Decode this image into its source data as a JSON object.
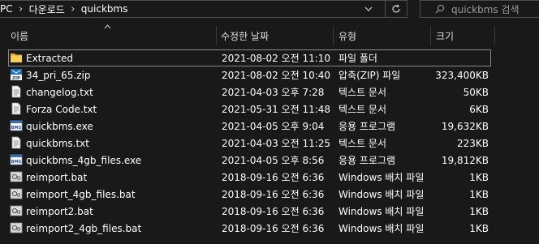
{
  "address_bar": {
    "crumbs": [
      "PC",
      "다운로드",
      "quickbms"
    ]
  },
  "search": {
    "placeholder": "quickbms 검색"
  },
  "columns": {
    "name": "이름",
    "date": "수정한 날짜",
    "type": "유형",
    "size": "크기"
  },
  "files": [
    {
      "name": "Extracted",
      "date": "2021-08-02 오전 11:10",
      "type": "파일 폴더",
      "size": "",
      "icon": "folder-icon",
      "selected": true
    },
    {
      "name": "34_pri_65.zip",
      "date": "2021-08-02 오전 10:40",
      "type": "압축(ZIP) 파일",
      "size": "323,400KB",
      "icon": "zip-icon"
    },
    {
      "name": "changelog.txt",
      "date": "2021-04-03 오후 7:28",
      "type": "텍스트 문서",
      "size": "50KB",
      "icon": "text-file-icon"
    },
    {
      "name": "Forza Code.txt",
      "date": "2021-05-31 오전 11:48",
      "type": "텍스트 문서",
      "size": "6KB",
      "icon": "text-file-icon"
    },
    {
      "name": "quickbms.exe",
      "date": "2021-04-05 오후 9:04",
      "type": "응용 프로그램",
      "size": "19,632KB",
      "icon": "exe-icon"
    },
    {
      "name": "quickbms.txt",
      "date": "2021-04-03 오전 11:25",
      "type": "텍스트 문서",
      "size": "223KB",
      "icon": "text-file-icon"
    },
    {
      "name": "quickbms_4gb_files.exe",
      "date": "2021-04-05 오후 8:56",
      "type": "응용 프로그램",
      "size": "19,812KB",
      "icon": "exe-icon"
    },
    {
      "name": "reimport.bat",
      "date": "2018-09-16 오전 6:36",
      "type": "Windows 배치 파일",
      "size": "1KB",
      "icon": "batch-file-icon"
    },
    {
      "name": "reimport_4gb_files.bat",
      "date": "2018-09-16 오전 6:36",
      "type": "Windows 배치 파일",
      "size": "1KB",
      "icon": "batch-file-icon"
    },
    {
      "name": "reimport2.bat",
      "date": "2018-09-16 오전 6:36",
      "type": "Windows 배치 파일",
      "size": "1KB",
      "icon": "batch-file-icon"
    },
    {
      "name": "reimport2_4gb_files.bat",
      "date": "2018-09-16 오전 6:36",
      "type": "Windows 배치 파일",
      "size": "1KB",
      "icon": "batch-file-icon"
    }
  ]
}
